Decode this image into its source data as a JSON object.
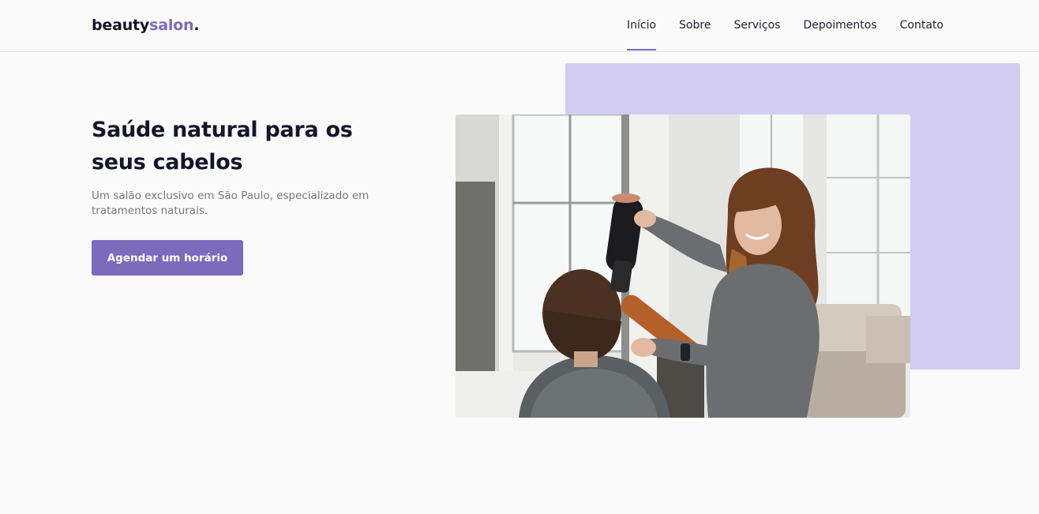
{
  "header": {
    "logo": {
      "part1": "beauty",
      "part2": "salon",
      "part3": "."
    },
    "nav": [
      {
        "label": "Início",
        "active": true
      },
      {
        "label": "Sobre",
        "active": false
      },
      {
        "label": "Serviços",
        "active": false
      },
      {
        "label": "Depoimentos",
        "active": false
      },
      {
        "label": "Contato",
        "active": false
      }
    ]
  },
  "hero": {
    "title": "Saúde natural para os seus cabelos",
    "subtitle": "Um salão exclusivo em São Paulo, especializado em tratamentos naturais.",
    "cta_label": "Agendar um horário",
    "image_icon": "salon-photo"
  },
  "colors": {
    "accent": "#7b6bbd",
    "accent_light": "#d3ccf2",
    "background": "#fafafa",
    "text_dark": "#15152a",
    "text_muted": "#767680"
  }
}
